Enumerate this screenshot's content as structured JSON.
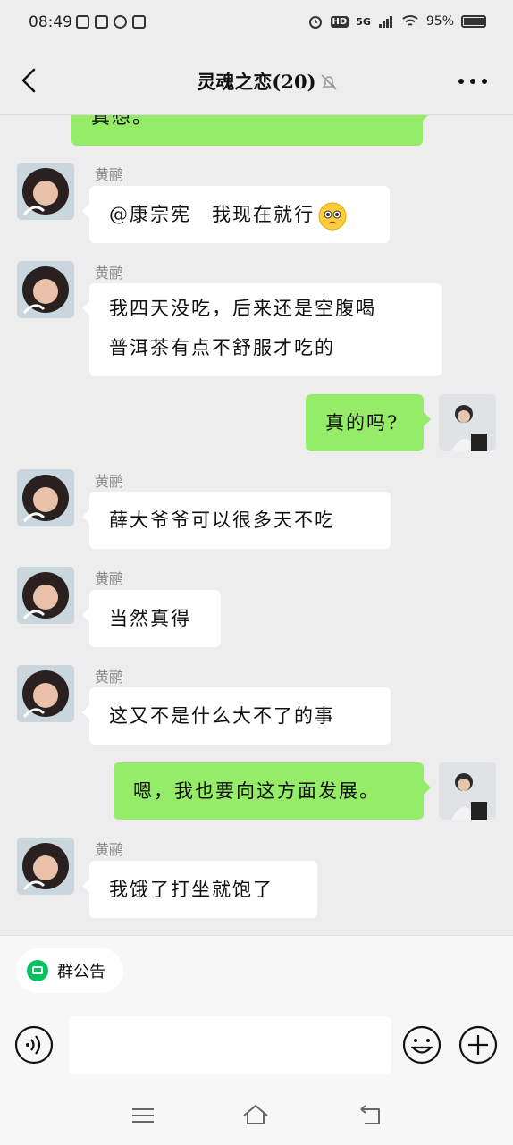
{
  "status": {
    "time": "08:49",
    "battery": "95%",
    "network": "5G",
    "hd": "HD"
  },
  "header": {
    "title": "灵魂之恋(20)"
  },
  "messages": [
    {
      "text": "真想。"
    },
    {
      "sender": "黄鹂",
      "text": "@康宗宪　我现在就行"
    },
    {
      "sender": "黄鹂",
      "line1": "我四天没吃，后来还是空腹喝",
      "line2": "普洱茶有点不舒服才吃的"
    },
    {
      "text": "真的吗?"
    },
    {
      "sender": "黄鹂",
      "text": "薛大爷爷可以很多天不吃"
    },
    {
      "sender": "黄鹂",
      "text": "当然真得"
    },
    {
      "sender": "黄鹂",
      "text": "这又不是什么大不了的事"
    },
    {
      "text": "嗯，我也要向这方面发展。"
    },
    {
      "sender": "黄鹂",
      "text": "我饿了打坐就饱了"
    }
  ],
  "footer": {
    "notice_label": "群公告",
    "input_value": ""
  },
  "colors": {
    "accent": "#07c160",
    "bubble_out": "#95ec69",
    "bubble_in": "#ffffff",
    "background": "#ededed"
  },
  "icons": [
    "back-icon",
    "mute-bell-icon",
    "more-icon",
    "voice-icon",
    "emoji-icon",
    "plus-icon",
    "menu-icon",
    "home-icon",
    "back-nav-icon",
    "announcement-icon"
  ]
}
